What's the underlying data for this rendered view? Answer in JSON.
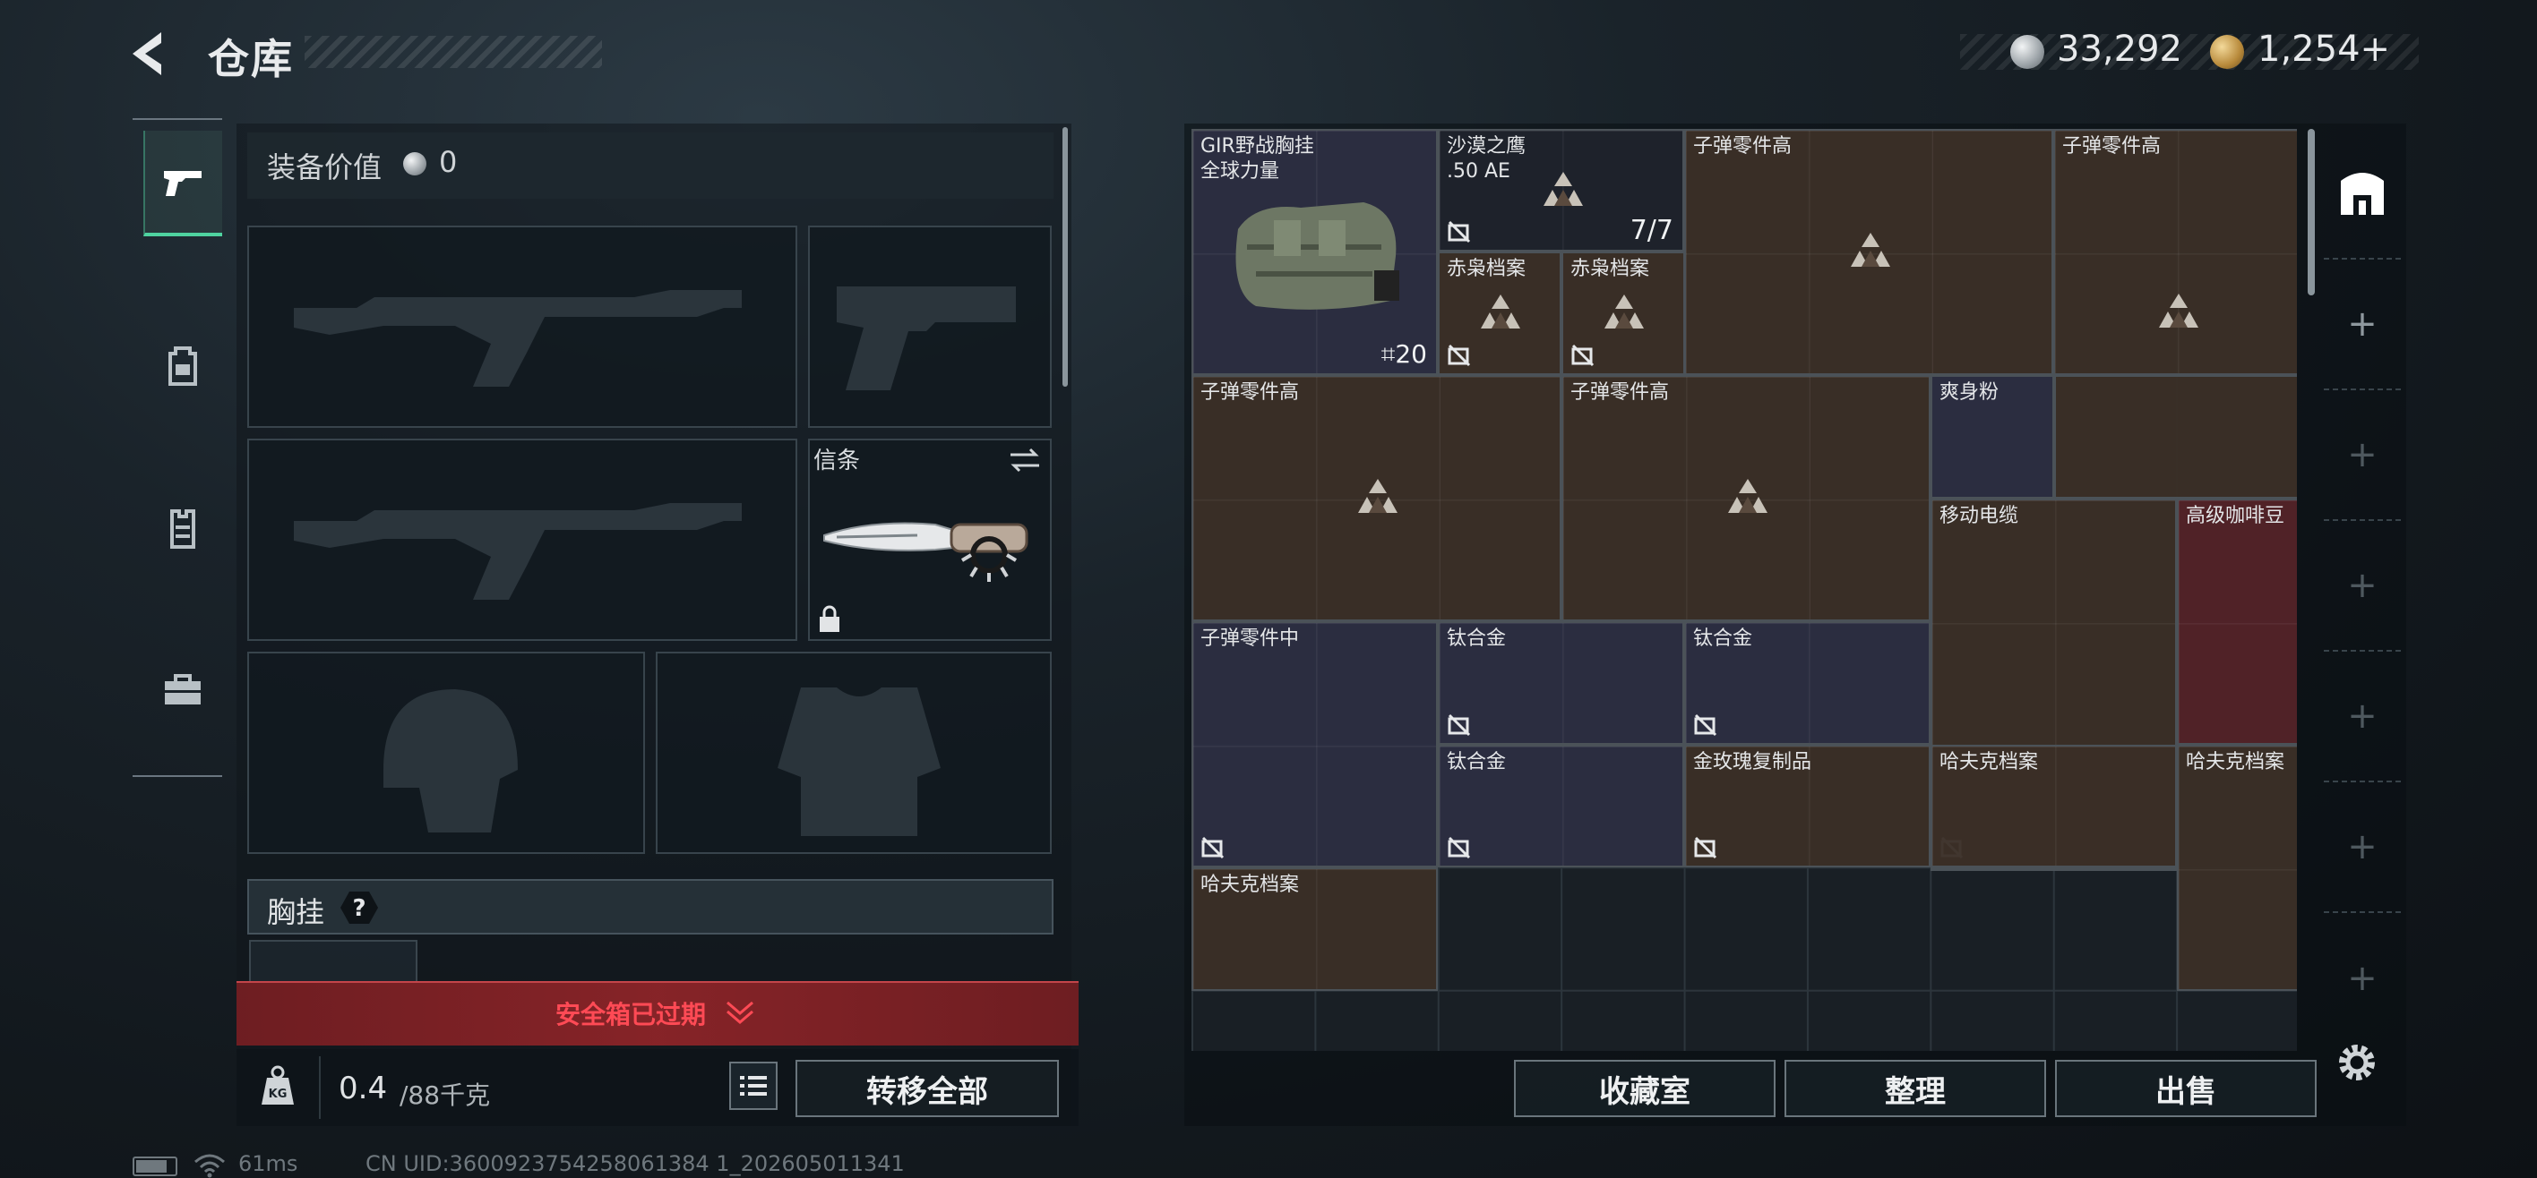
{
  "header": {
    "title": "仓库",
    "currency_silver": "33,292",
    "currency_gold": "1,254",
    "currency_add": "+"
  },
  "left_nav": {
    "items": [
      "pistol-icon",
      "backpack-icon",
      "vest-icon",
      "case-icon"
    ],
    "active": "pistol-icon"
  },
  "equipment": {
    "value_label": "装备价值",
    "value": "0",
    "melee_label": "信条",
    "vest_label": "胸挂",
    "vest_help": "?",
    "safe_box_status": "安全箱已过期"
  },
  "weight": {
    "value": "0.4",
    "max": "/88千克"
  },
  "buttons": {
    "transfer_all": "转移全部",
    "collection": "收藏室",
    "sort": "整理",
    "sell": "出售"
  },
  "grid_items": [
    {
      "name": "GIR野战胸挂",
      "name2": "全球力量",
      "count": "20"
    },
    {
      "name": "沙漠之鹰",
      "name2": ".50 AE",
      "ammo": "7/7"
    },
    {
      "name": "子弹零件高"
    },
    {
      "name": "子弹零件高"
    },
    {
      "name": "赤枭档案"
    },
    {
      "name": "赤枭档案"
    },
    {
      "name": "子弹零件高"
    },
    {
      "name": "子弹零件高"
    },
    {
      "name": "爽身粉"
    },
    {
      "name": "移动电缆"
    },
    {
      "name": "高级咖啡豆"
    },
    {
      "name": "子弹零件中"
    },
    {
      "name": "钛合金"
    },
    {
      "name": "钛合金"
    },
    {
      "name": "钛合金"
    },
    {
      "name": "金玫瑰复制品"
    },
    {
      "name": "哈夫克档案"
    },
    {
      "name": "哈夫克档案"
    },
    {
      "name": "哈夫克档案"
    }
  ],
  "side_column": [
    "safe-icon",
    "+",
    "+",
    "+",
    "+",
    "+",
    "+"
  ],
  "status_bar": {
    "ping": "61ms",
    "uid": "CN UID:3600923754258061384 1_202605011341"
  },
  "colors": {
    "accent_green": "#4fd3a0",
    "warning_red": "#ff4a55",
    "item_brown": "#3a2f26",
    "item_blue": "#2c2e42",
    "item_red": "#522228"
  }
}
